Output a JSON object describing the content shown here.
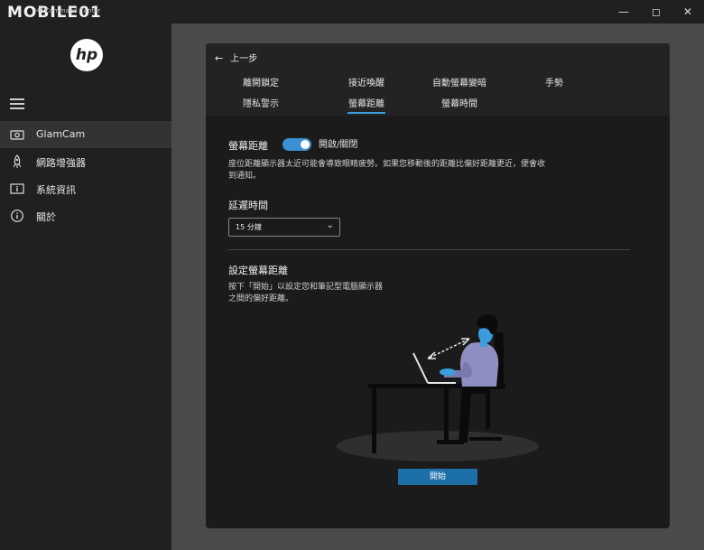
{
  "window": {
    "brand": "MOBILE01",
    "subtitle": "HP Command Center",
    "min_icon": "minimize-icon",
    "max_icon": "maximize-icon",
    "close_icon": "close-icon"
  },
  "sidebar": {
    "logo": "hp",
    "items": [
      {
        "label": "GlamCam",
        "icon": "camera-icon",
        "active": true
      },
      {
        "label": "網路增強器",
        "icon": "rocket-icon",
        "active": false
      },
      {
        "label": "系統資訊",
        "icon": "info-box-icon",
        "active": false
      },
      {
        "label": "關於",
        "icon": "info-circle-icon",
        "active": false
      }
    ]
  },
  "header": {
    "back_label": "上一步",
    "tabs": [
      {
        "label": "離開鎖定"
      },
      {
        "label": "接近喚醒"
      },
      {
        "label": "自動螢幕變暗"
      },
      {
        "label": "手勢"
      },
      {
        "label": "隱私警示"
      },
      {
        "label": "螢幕距離",
        "active": true
      },
      {
        "label": "螢幕時間"
      }
    ]
  },
  "screen_distance": {
    "title": "螢幕距離",
    "toggle_label": "開啟/關閉",
    "toggle_on": true,
    "description_line1": "座位距離顯示器太近可能會導致眼睛疲勞。如果您移動後的距離比偏好距離更近，便會收",
    "description_line2": "到通知。"
  },
  "delay": {
    "title": "延遲時間",
    "selected": "15 分鐘"
  },
  "set_distance": {
    "title": "設定螢幕距離",
    "line1": "按下「開始」以設定您和筆記型電腦顯示器",
    "line2": "之間的偏好距離。",
    "start_label": "開始"
  },
  "colors": {
    "accent": "#3b8fd4",
    "button": "#1d6fa8"
  }
}
